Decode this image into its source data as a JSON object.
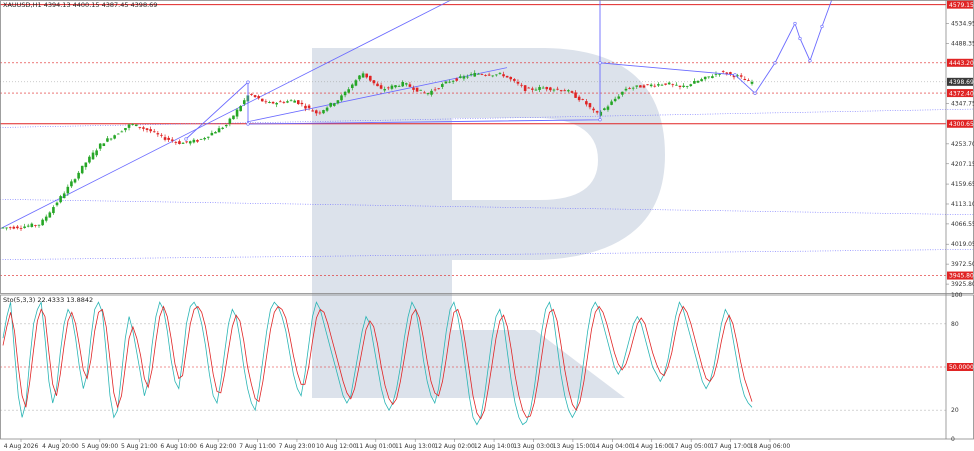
{
  "header": {
    "symbol_info": "XAUUSD,H1  4394.13 4400.15 4387.45 4398.69"
  },
  "stoch_header": {
    "label": "Sto(5,3,3) 22.4333 13.8842"
  },
  "colors": {
    "bull": "#26a626",
    "bear": "#e02424",
    "support_resistance": "#e02424",
    "projection": "#6b6bff",
    "trend": "#6b6bff",
    "stoch_main": "#2bb5b5",
    "stoch_signal": "#e02424",
    "watermark": "#d6dde8",
    "current_price_bg": "#3a3a3a"
  },
  "chart_data": [
    {
      "type": "candlestick",
      "title": "XAUUSD,H1",
      "y_ticks": [
        4579.15,
        4534.95,
        4488.35,
        4443.2,
        4398.69,
        4347.75,
        4300.65,
        4253.7,
        4207.15,
        4159.65,
        4113.1,
        4066.55,
        4019.05,
        3972.5,
        3925.8
      ],
      "x_ticks": [
        "4 Aug 2026",
        "4 Aug 20:00",
        "5 Aug 09:00",
        "5 Aug 21:00",
        "6 Aug 10:00",
        "6 Aug 22:00",
        "7 Aug 11:00",
        "7 Aug 23:00",
        "10 Aug 12:00",
        "11 Aug 01:00",
        "11 Aug 13:00",
        "12 Aug 02:00",
        "12 Aug 14:00",
        "13 Aug 03:00",
        "13 Aug 15:00",
        "14 Aug 04:00",
        "14 Aug 16:00",
        "17 Aug 05:00",
        "17 Aug 17:00",
        "18 Aug 06:00"
      ],
      "ylim": [
        3905,
        4590
      ],
      "price_lines": [
        {
          "value": 4579.15,
          "label": "4579.15",
          "style": "solid"
        },
        {
          "value": 4443.2,
          "label": "4443.20",
          "style": "dashed"
        },
        {
          "value": 4398.69,
          "label": "4398.69",
          "style": "current"
        },
        {
          "value": 4372.4,
          "label": "4372.40",
          "style": "dashed"
        },
        {
          "value": 4300.65,
          "label": "4300.65",
          "style": "solid"
        },
        {
          "value": 3945.8,
          "label": "3945.80",
          "style": "dashed"
        }
      ],
      "candles": {
        "count": 209,
        "first_x": 0,
        "last_x": 208,
        "anchors": [
          [
            0,
            4057
          ],
          [
            10,
            4060
          ],
          [
            18,
            4066
          ],
          [
            30,
            4150
          ],
          [
            38,
            4210
          ],
          [
            45,
            4255
          ],
          [
            58,
            4300
          ],
          [
            66,
            4285
          ],
          [
            72,
            4268
          ],
          [
            80,
            4255
          ],
          [
            88,
            4262
          ],
          [
            100,
            4298
          ],
          [
            110,
            4370
          ],
          [
            118,
            4348
          ],
          [
            130,
            4355
          ],
          [
            140,
            4325
          ],
          [
            150,
            4360
          ],
          [
            160,
            4420
          ],
          [
            168,
            4380
          ],
          [
            178,
            4395
          ],
          [
            188,
            4370
          ],
          [
            198,
            4400
          ],
          [
            210,
            4418
          ],
          [
            222,
            4415
          ],
          [
            232,
            4380
          ],
          [
            240,
            4385
          ],
          [
            250,
            4378
          ],
          [
            258,
            4350
          ],
          [
            263,
            4322
          ],
          [
            268,
            4342
          ],
          [
            276,
            4383
          ],
          [
            285,
            4390
          ],
          [
            294,
            4395
          ],
          [
            300,
            4385
          ],
          [
            310,
            4405
          ],
          [
            318,
            4422
          ],
          [
            326,
            4410
          ],
          [
            330,
            4398
          ]
        ],
        "volatility": 8
      },
      "trend_lines": [
        {
          "x": [
            0,
            483
          ],
          "y": [
            4055,
            4628
          ]
        },
        {
          "x": [
            247,
            507
          ],
          "y": [
            4305,
            4432
          ]
        },
        {
          "x": [
            0,
            974
          ],
          "y": [
            4292,
            4335
          ]
        },
        {
          "x": [
            0,
            974
          ],
          "y": [
            4124,
            4088
          ]
        },
        {
          "x": [
            0,
            974
          ],
          "y": [
            3983,
            4007
          ]
        }
      ],
      "projection_path": {
        "x": [
          186,
          248,
          248,
          600,
          600,
          600,
          735,
          755,
          775,
          795,
          800,
          810,
          822,
          838
        ],
        "y": [
          4265,
          4398,
          4300,
          4310,
          4628,
          4443,
          4415,
          4372,
          4443,
          4535,
          4500,
          4448,
          4528,
          4630
        ]
      }
    },
    {
      "type": "line",
      "title": "Sto(5,3,3)",
      "y_ticks": [
        100,
        80,
        50,
        20,
        0
      ],
      "ylim": [
        0,
        100
      ],
      "levels": [
        80,
        50,
        20
      ],
      "level_label": "50.0000",
      "series": [
        {
          "role": "main",
          "values": [
            70,
            85,
            95,
            60,
            30,
            15,
            25,
            55,
            80,
            90,
            95,
            70,
            40,
            25,
            35,
            60,
            80,
            90,
            85,
            70,
            50,
            35,
            45,
            70,
            90,
            95,
            88,
            60,
            30,
            15,
            20,
            45,
            70,
            85,
            75,
            60,
            45,
            30,
            40,
            65,
            85,
            95,
            90,
            75,
            55,
            40,
            35,
            55,
            80,
            92,
            95,
            90,
            80,
            65,
            45,
            30,
            25,
            40,
            60,
            80,
            90,
            85,
            70,
            50,
            35,
            25,
            20,
            35,
            55,
            75,
            90,
            95,
            92,
            85,
            75,
            60,
            45,
            35,
            30,
            45,
            65,
            85,
            95,
            90,
            80,
            70,
            60,
            50,
            40,
            30,
            25,
            30,
            45,
            60,
            75,
            85,
            80,
            65,
            50,
            35,
            25,
            20,
            25,
            35,
            50,
            70,
            85,
            95,
            90,
            75,
            55,
            40,
            30,
            25,
            35,
            55,
            75,
            90,
            95,
            85,
            70,
            50,
            30,
            15,
            10,
            15,
            30,
            50,
            70,
            85,
            90,
            80,
            60,
            40,
            25,
            15,
            10,
            12,
            20,
            35,
            55,
            75,
            90,
            95,
            85,
            65,
            45,
            30,
            20,
            15,
            20,
            35,
            55,
            75,
            90,
            95,
            90,
            80,
            70,
            60,
            50,
            45,
            50,
            60,
            70,
            80,
            85,
            80,
            70,
            60,
            50,
            45,
            40,
            45,
            55,
            70,
            85,
            95,
            90,
            80,
            70,
            60,
            50,
            40,
            35,
            40,
            50,
            65,
            80,
            90,
            85,
            70,
            55,
            40,
            30,
            25,
            22
          ]
        },
        {
          "role": "signal",
          "values": [
            65,
            78,
            88,
            75,
            50,
            30,
            22,
            40,
            62,
            82,
            90,
            85,
            60,
            38,
            30,
            45,
            65,
            82,
            88,
            80,
            65,
            48,
            42,
            55,
            75,
            88,
            90,
            78,
            55,
            32,
            22,
            30,
            50,
            70,
            78,
            70,
            58,
            42,
            36,
            48,
            68,
            85,
            92,
            85,
            70,
            52,
            42,
            44,
            62,
            80,
            90,
            92,
            88,
            78,
            62,
            45,
            33,
            32,
            45,
            62,
            78,
            86,
            82,
            68,
            50,
            38,
            28,
            26,
            40,
            58,
            76,
            88,
            92,
            90,
            84,
            72,
            58,
            46,
            38,
            38,
            50,
            68,
            84,
            90,
            88,
            80,
            70,
            60,
            50,
            40,
            32,
            28,
            35,
            48,
            62,
            76,
            82,
            78,
            66,
            50,
            37,
            28,
            24,
            28,
            40,
            56,
            72,
            86,
            90,
            84,
            70,
            54,
            40,
            32,
            30,
            40,
            56,
            74,
            88,
            90,
            82,
            66,
            48,
            30,
            18,
            14,
            20,
            35,
            52,
            70,
            82,
            86,
            78,
            62,
            44,
            30,
            20,
            15,
            16,
            25,
            40,
            58,
            76,
            88,
            90,
            82,
            66,
            48,
            34,
            24,
            20,
            26,
            40,
            58,
            76,
            88,
            92,
            88,
            80,
            70,
            60,
            52,
            48,
            52,
            60,
            70,
            80,
            84,
            80,
            70,
            60,
            52,
            46,
            44,
            50,
            60,
            74,
            86,
            92,
            88,
            80,
            70,
            60,
            50,
            42,
            40,
            44,
            54,
            68,
            80,
            86,
            80,
            68,
            54,
            42,
            34,
            26
          ]
        }
      ]
    }
  ]
}
